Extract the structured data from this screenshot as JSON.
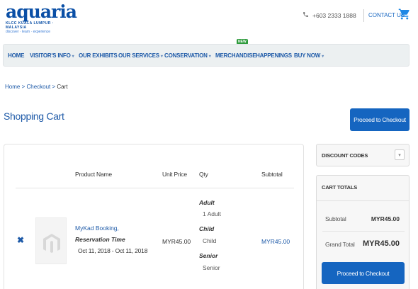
{
  "header": {
    "logo_main": "aquaria",
    "logo_sub": "KLCC KUALA LUMPUR · MALAYSIA",
    "logo_tagline": "discover · learn · experience",
    "phone": "+603 2333 1888",
    "contact": "CONTACT US"
  },
  "nav": {
    "items": [
      {
        "label": "HOME",
        "has_caret": false
      },
      {
        "label": "VISITOR'S INFO",
        "has_caret": true
      },
      {
        "label": "OUR EXHIBITS",
        "has_caret": false
      },
      {
        "label": "OUR SERVICES",
        "has_caret": true
      },
      {
        "label": "CONSERVATION",
        "has_caret": true
      },
      {
        "label": "MERCHANDISE",
        "has_caret": false
      },
      {
        "label": "HAPPENINGS",
        "has_caret": false
      },
      {
        "label": "BUY NOW",
        "has_caret": true
      }
    ],
    "new_badge": "NEW",
    "caret": "▾"
  },
  "breadcrumb": {
    "home": "Home",
    "sep1": " > ",
    "checkout": "Checkout",
    "sep2": " > ",
    "current": "Cart"
  },
  "page": {
    "title": "Shopping Cart",
    "proceed_label": "Proceed to Checkout"
  },
  "cart": {
    "headers": {
      "product": "Product Name",
      "unit_price": "Unit Price",
      "qty": "Qty",
      "subtotal": "Subtotal"
    },
    "item": {
      "remove_glyph": "✖",
      "name": "MyKad Booking,",
      "reservation_label": "Reservation Time",
      "reservation_dates": "Oct 11, 2018 - Oct 11, 2018",
      "unit_price": "MYR45.00",
      "qty": [
        {
          "label": "Adult",
          "value": "1 Adult"
        },
        {
          "label": "Child",
          "value": "Child"
        },
        {
          "label": "Senior",
          "value": "Senior"
        }
      ],
      "subtotal": "MYR45.00"
    }
  },
  "sidebar": {
    "discount_title": "DISCOUNT CODES",
    "discount_toggle": "▾",
    "totals_title": "CART TOTALS",
    "subtotal_label": "Subtotal",
    "subtotal_value": "MYR45.00",
    "grand_total_label": "Grand Total",
    "grand_total_value": "MYR45.00",
    "proceed_label": "Proceed to Checkout"
  },
  "colors": {
    "brand_blue": "#1565c0",
    "nav_bg": "#ecf0f1",
    "new_badge": "#2e9b3c"
  },
  "icons": {
    "phone": "phone-icon",
    "cart": "cart-icon",
    "remove": "close-icon",
    "product_placeholder": "magento-logo-icon"
  }
}
